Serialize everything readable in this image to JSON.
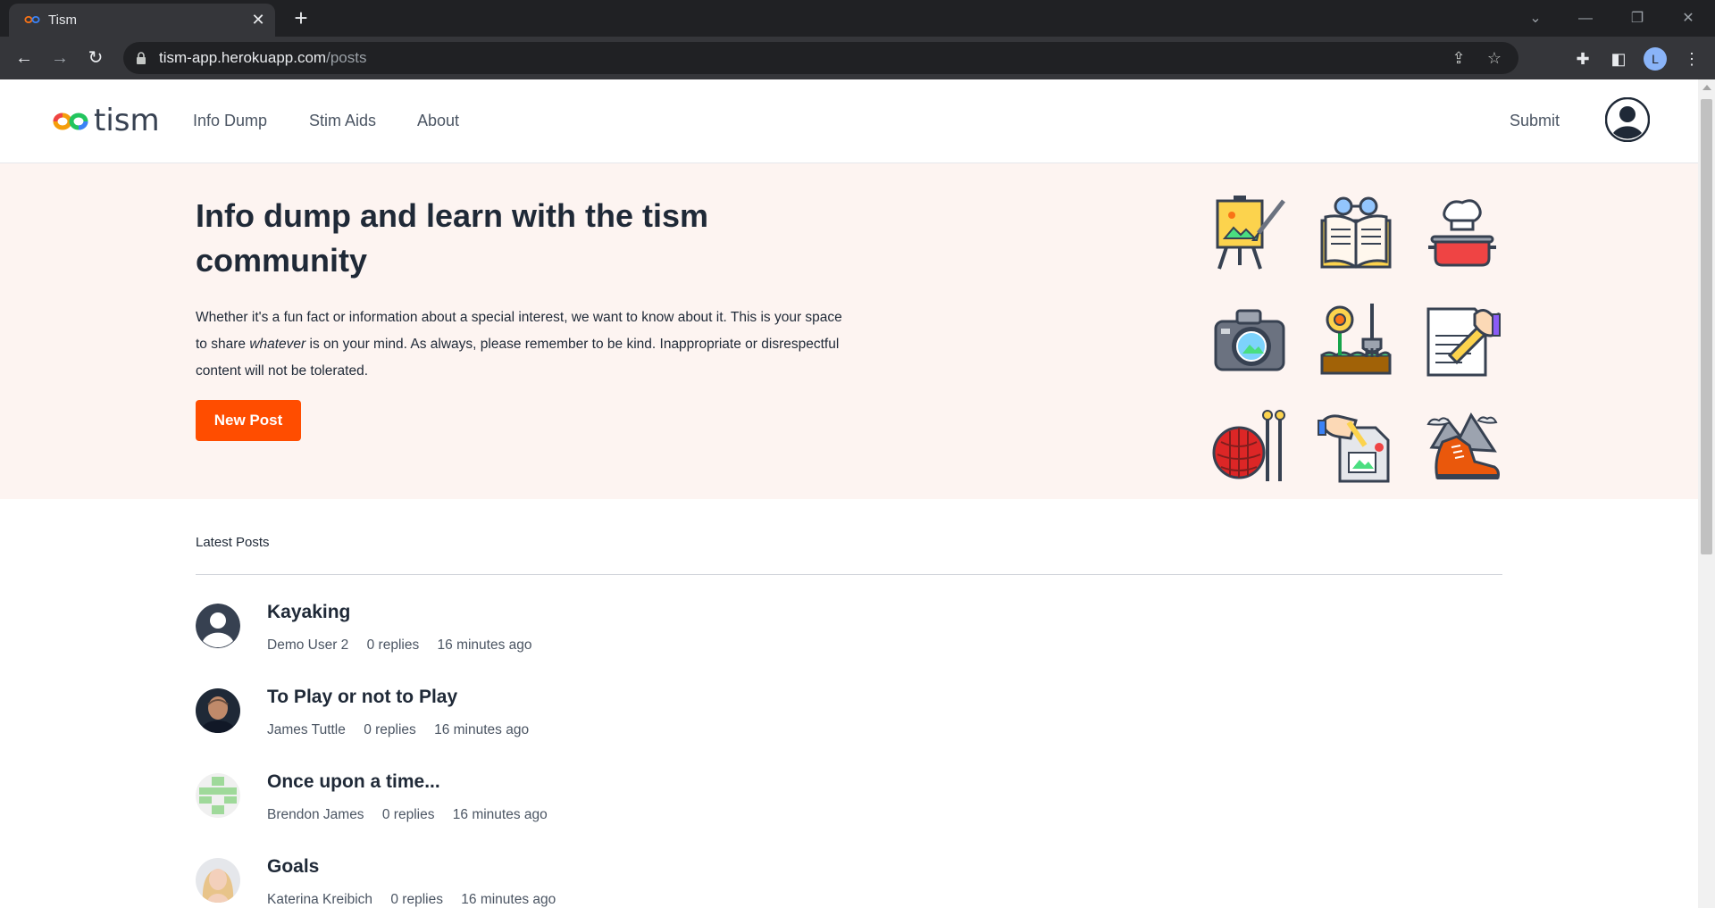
{
  "browser": {
    "tab_title": "Tism",
    "url_host": "tism-app.herokuapp.com",
    "url_path": "/posts",
    "profile_initial": "L"
  },
  "header": {
    "logo_text": "tism",
    "nav": [
      "Info Dump",
      "Stim Aids",
      "About"
    ],
    "submit_label": "Submit"
  },
  "hero": {
    "title": "Info dump and learn with the tism community",
    "text_before": "Whether it's a fun fact or information about a special interest, we want to know about it. This is your space to share ",
    "text_emphasis": "whatever",
    "text_after": " is on your mind. As always, please remember to be kind. Inappropriate or disrespectful content will not be tolerated.",
    "button_label": "New Post",
    "icons": [
      "art-easel-icon",
      "reading-book-icon",
      "cooking-pot-icon",
      "camera-icon",
      "gardening-icon",
      "writing-icon",
      "knitting-icon",
      "drawing-icon",
      "hiking-boot-icon"
    ]
  },
  "posts": {
    "section_label": "Latest Posts",
    "items": [
      {
        "title": "Kayaking",
        "author": "Demo User 2",
        "replies": "0 replies",
        "time": "16 minutes ago",
        "avatar": "default-avatar"
      },
      {
        "title": "To Play or not to Play",
        "author": "James Tuttle",
        "replies": "0 replies",
        "time": "16 minutes ago",
        "avatar": "photo-avatar"
      },
      {
        "title": "Once upon a time...",
        "author": "Brendon James",
        "replies": "0 replies",
        "time": "16 minutes ago",
        "avatar": "identicon-avatar"
      },
      {
        "title": "Goals",
        "author": "Katerina Kreibich",
        "replies": "0 replies",
        "time": "16 minutes ago",
        "avatar": "photo-avatar"
      }
    ]
  },
  "colors": {
    "accent": "#ff4d00",
    "hero_bg": "#fdf4f1",
    "text": "#1f2937"
  }
}
